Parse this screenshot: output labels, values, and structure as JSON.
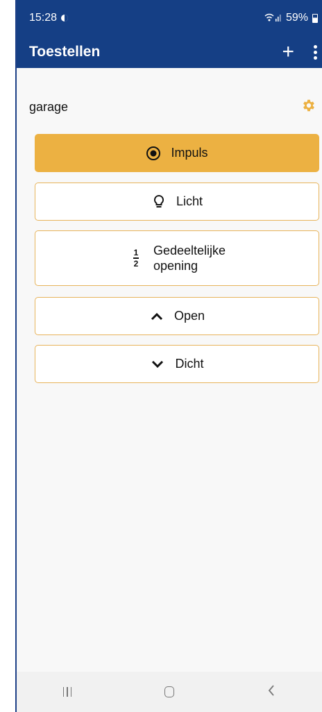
{
  "status": {
    "time": "15:28",
    "battery": "59%"
  },
  "appbar": {
    "title": "Toestellen"
  },
  "device": {
    "name": "garage"
  },
  "buttons": [
    {
      "label": "Impuls",
      "icon": "radio-button-icon",
      "active": true
    },
    {
      "label": "Licht",
      "icon": "lightbulb-icon",
      "active": false
    },
    {
      "label_line1": "Gedeeltelijke",
      "label_line2": "opening",
      "icon": "half-fraction-icon",
      "fraction_num": "1",
      "fraction_den": "2",
      "active": false
    },
    {
      "label": "Open",
      "icon": "chevron-up-icon",
      "active": false
    },
    {
      "label": "Dicht",
      "icon": "chevron-down-icon",
      "active": false
    }
  ],
  "colors": {
    "primary": "#153f85",
    "accent": "#ecb142",
    "border": "#e7b35a"
  }
}
